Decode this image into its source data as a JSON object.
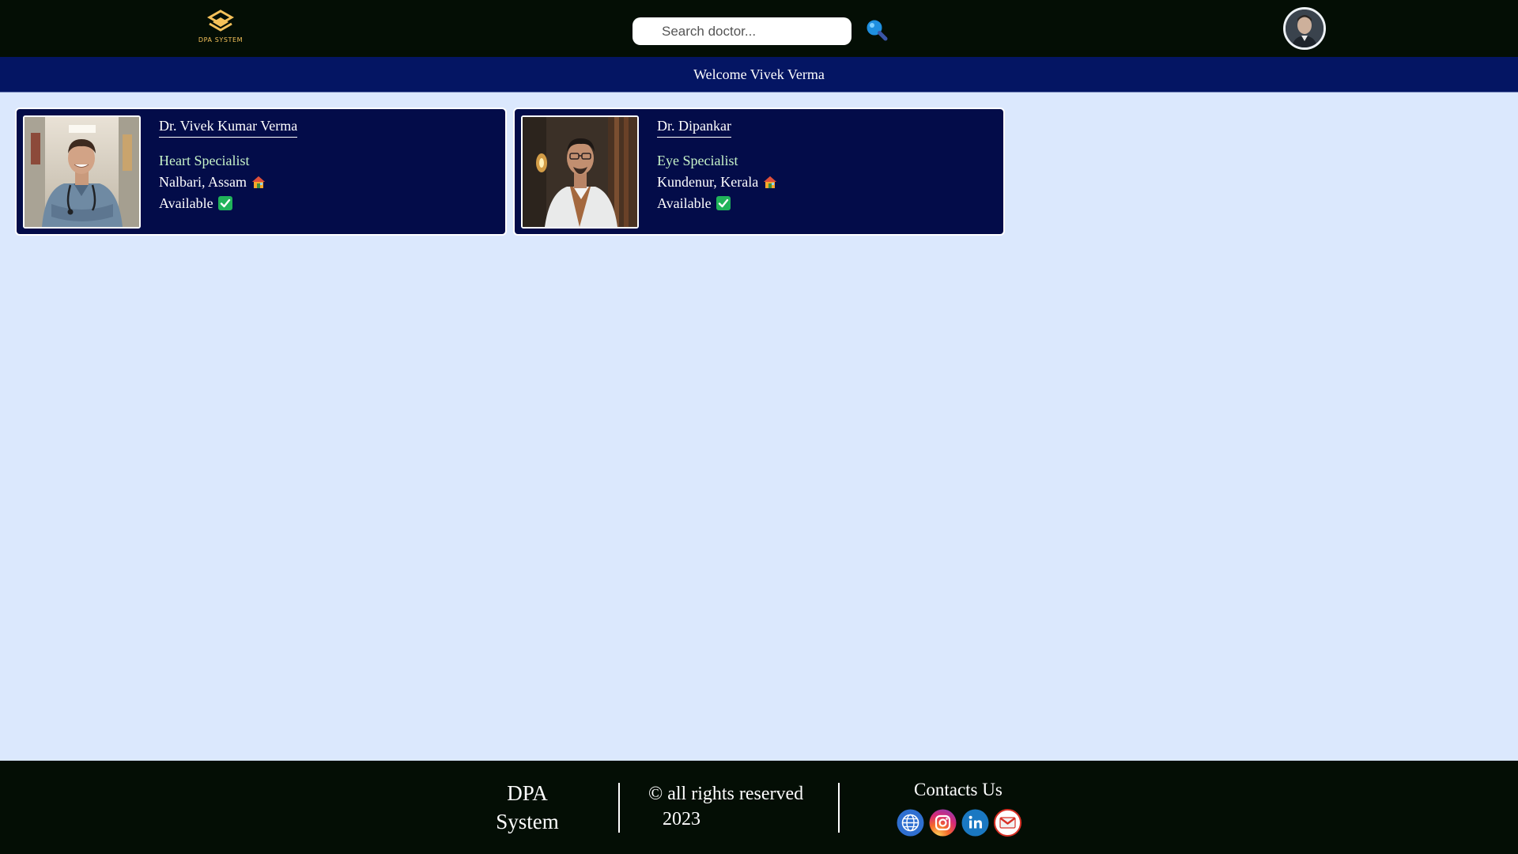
{
  "header": {
    "logo_text": "DPA SYSTEM",
    "search": {
      "placeholder": "Search doctor...",
      "value": ""
    },
    "search_icon": "magnifier-icon",
    "avatar_icon": "user-avatar"
  },
  "welcome": {
    "text": "Welcome Vivek Verma"
  },
  "doctors": [
    {
      "name": "Dr. Vivek Kumar Verma",
      "specialty": "Heart Specialist",
      "location": "Nalbari, Assam",
      "status": "Available",
      "location_icon": "house-icon",
      "status_icon": "check-box-icon"
    },
    {
      "name": "Dr. Dipankar",
      "specialty": "Eye Specialist",
      "location": "Kundenur, Kerala",
      "status": "Available",
      "location_icon": "house-icon",
      "status_icon": "check-box-icon"
    }
  ],
  "footer": {
    "brand_line1": "DPA",
    "brand_line2": "System",
    "copyright_line1": "© all rights reserved",
    "copyright_line2": "2023",
    "contacts_title": "Contacts Us",
    "social": [
      "globe-icon",
      "instagram-icon",
      "linkedin-icon",
      "gmail-icon"
    ]
  },
  "colors": {
    "header_bg": "#040e05",
    "welcome_bg": "#041563",
    "card_bg": "#030c49",
    "page_bg": "#dbe8fd",
    "specialty_text": "#c6f2c8",
    "accent_logo": "#f5c15a",
    "check_green": "#21b35a"
  }
}
